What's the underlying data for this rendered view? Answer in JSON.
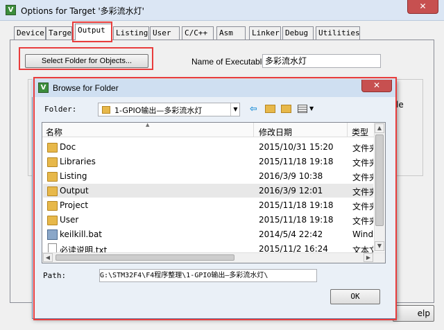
{
  "window": {
    "title": "Options for Target '多彩流水灯'",
    "close_glyph": "✕",
    "icon_glyph": "V",
    "behind_help": "elp",
    "behind_ile": "le"
  },
  "tabs": [
    {
      "label": "Device",
      "active": false
    },
    {
      "label": "Target",
      "active": false
    },
    {
      "label": "Output",
      "active": true
    },
    {
      "label": "Listing",
      "active": false
    },
    {
      "label": "User",
      "active": false
    },
    {
      "label": "C/C++",
      "active": false
    },
    {
      "label": "Asm",
      "active": false
    },
    {
      "label": "Linker",
      "active": false
    },
    {
      "label": "Debug",
      "active": false
    },
    {
      "label": "Utilities",
      "active": false
    }
  ],
  "output": {
    "select_folder_button": "Select Folder for Objects...",
    "name_label": "Name of Executable:",
    "name_value": "多彩流水灯"
  },
  "browse_dialog": {
    "title": "Browse for Folder",
    "icon_glyph": "V",
    "close_glyph": "✕",
    "folder_label": "Folder:",
    "folder_value": "1-GPIO输出—多彩流水灯",
    "columns": {
      "name": "名称",
      "modified": "修改日期",
      "type": "类型"
    },
    "rows": [
      {
        "name": "Doc",
        "modified": "2015/10/31 15:20",
        "type": "文件夹",
        "kind": "folder"
      },
      {
        "name": "Libraries",
        "modified": "2015/11/18 19:18",
        "type": "文件夹",
        "kind": "folder"
      },
      {
        "name": "Listing",
        "modified": "2016/3/9 10:38",
        "type": "文件夹",
        "kind": "folder"
      },
      {
        "name": "Output",
        "modified": "2016/3/9 12:01",
        "type": "文件夹",
        "kind": "folder",
        "selected": true
      },
      {
        "name": "Project",
        "modified": "2015/11/18 19:18",
        "type": "文件夹",
        "kind": "folder"
      },
      {
        "name": "User",
        "modified": "2015/11/18 19:18",
        "type": "文件夹",
        "kind": "folder"
      },
      {
        "name": "keilkill.bat",
        "modified": "2014/5/4 22:42",
        "type": "Windows",
        "kind": "bat"
      },
      {
        "name": "必读说明.txt",
        "modified": "2015/11/2 16:24",
        "type": "文本文档",
        "kind": "txt"
      }
    ],
    "path_label": "Path:",
    "path_value": "G:\\STM32F4\\F4程序整理\\1-GPIO输出—多彩流水灯\\",
    "ok_button": "OK"
  },
  "colors": {
    "highlight": "#e83c3c",
    "selected_row": "#e8e8e8",
    "dialog_bg": "#eaf0f7",
    "folder": "#e7b84a"
  },
  "icons": [
    "app-icon",
    "close-icon",
    "folder-icon",
    "back-icon",
    "up-folder-icon",
    "new-folder-icon",
    "view-menu-icon",
    "file-icon",
    "batch-file-icon"
  ]
}
